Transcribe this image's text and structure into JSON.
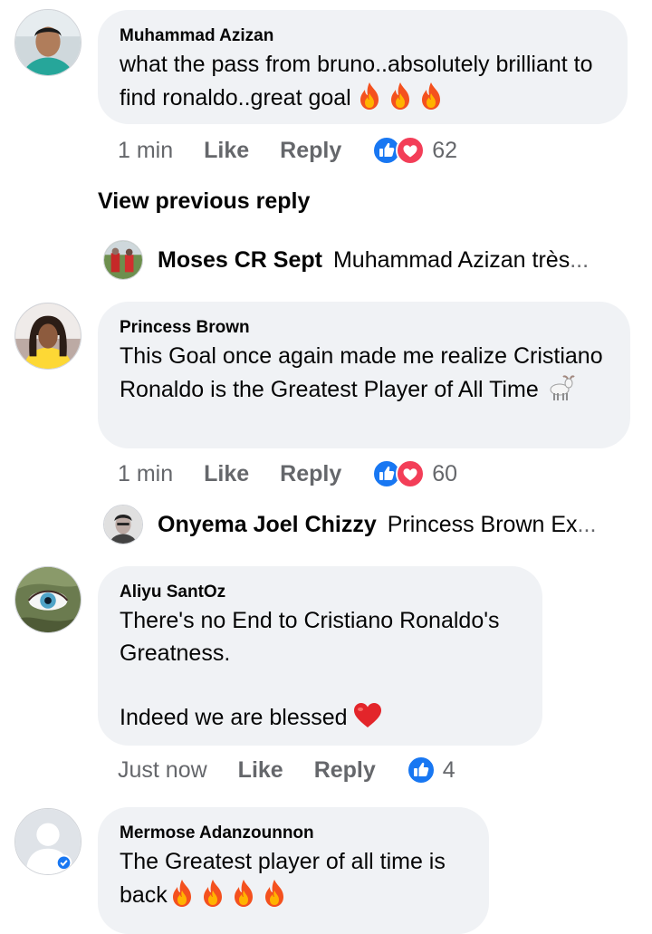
{
  "comments": [
    {
      "author": "Muhammad Azizan",
      "text": "what the pass from bruno..absolutely brilliant to find ronaldo..great goal",
      "time": "1 min",
      "like": "Like",
      "reply": "Reply",
      "reaction_count": "62",
      "emoji": "fire x3"
    },
    {
      "author": "Princess Brown",
      "text": "This Goal once again made me realize Cristiano Ronaldo is the Greatest Player of All Time",
      "time": "1 min",
      "like": "Like",
      "reply": "Reply",
      "reaction_count": "60",
      "emoji": "goat"
    },
    {
      "author": "Aliyu SantOz",
      "text": "There's no End to Cristiano Ronaldo's Greatness.\n\nIndeed we are blessed",
      "time": "Just now",
      "like": "Like",
      "reply": "Reply",
      "reaction_count": "4",
      "emoji": "red-heart"
    },
    {
      "author": "Mermose Adanzounnon",
      "text": "The Greatest player of all time is back",
      "emoji": "fire x4"
    }
  ],
  "view_previous": "View previous reply",
  "replies": [
    {
      "author": "Moses CR Sept",
      "text": "Muhammad Azizan très",
      "ellipsis": "..."
    },
    {
      "author": "Onyema Joel Chizzy",
      "text": "Princess Brown Ex",
      "ellipsis": "..."
    }
  ],
  "colors": {
    "bubble": "#f0f2f5",
    "meta": "#65676b",
    "like_blue": "#1877f2",
    "love_red": "#f33e58"
  }
}
